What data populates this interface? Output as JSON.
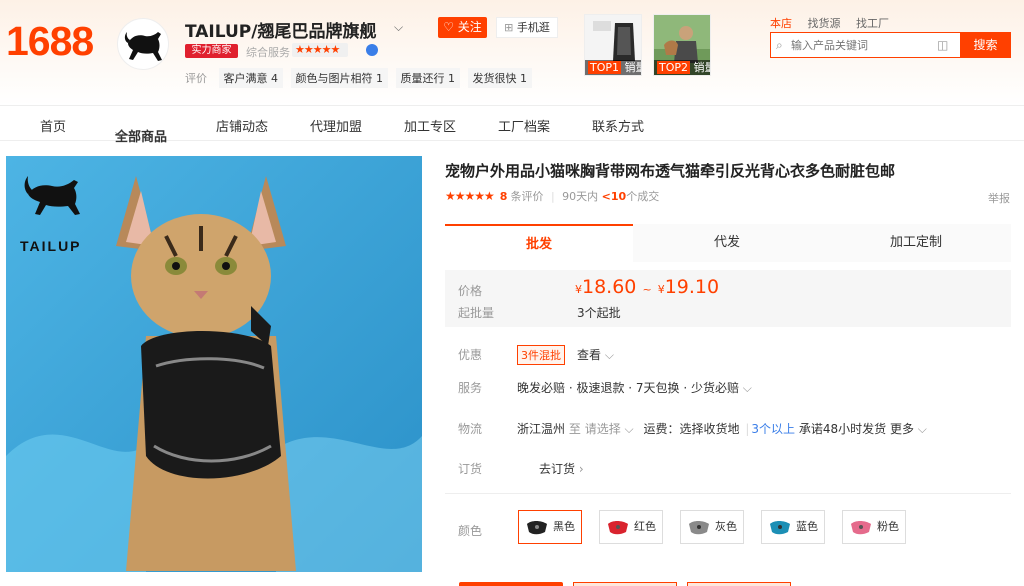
{
  "header": {
    "logo": "1688",
    "shop_name": "TAILUP/翘尾巴品牌旗舰",
    "follow_label": "关注",
    "mobile_label": "手机逛",
    "badge": "实力商家",
    "service_label": "综合服务",
    "stars": "★★★★★",
    "eval_label": "评价",
    "eval_tags": [
      "客户满意 4",
      "颜色与图片相符 1",
      "质量还行 1",
      "发货很快 1"
    ],
    "thumbs": [
      {
        "rank": "TOP1",
        "label": "销量"
      },
      {
        "rank": "TOP2",
        "label": "销量"
      }
    ],
    "search_tabs": [
      "本店",
      "找货源",
      "找工厂"
    ],
    "search_placeholder": "输入产品关键词",
    "search_button": "搜索"
  },
  "nav": [
    "首页",
    "全部商品",
    "店铺动态",
    "代理加盟",
    "加工专区",
    "工厂档案",
    "联系方式"
  ],
  "product": {
    "brand_text": "TAILUP",
    "title": "宠物户外用品小猫咪胸背带网布透气猫牵引反光背心衣多色耐脏包邮",
    "stars": "★★★★★",
    "review_count": "8",
    "review_suffix": "条评价",
    "sales_prefix": "90天内",
    "sales_value": "<10",
    "sales_suffix": "个成交",
    "report": "举报",
    "tabs": [
      "批发",
      "代发",
      "加工定制"
    ],
    "price_label": "价格",
    "currency": "¥",
    "price_low": "18.60",
    "price_sep": "~",
    "price_high": "19.10",
    "moq_label": "起批量",
    "moq_value": "3个起批",
    "promo_label": "优惠",
    "promo_tag": "3件混批",
    "promo_view": "查看",
    "service_label": "服务",
    "service_value": "晚发必赔 · 极速退款 · 7天包换 · 少货必赔",
    "logistics_label": "物流",
    "logistics_from": "浙江温州",
    "logistics_to": "至",
    "logistics_select": "请选择",
    "logistics_fee": "运费：选择收货地",
    "logistics_qty": "3个以上",
    "logistics_promise": "承诺48小时发货",
    "logistics_more": "更多",
    "order_label": "订货",
    "order_value": "去订货",
    "color_label": "颜色",
    "colors": [
      {
        "name": "黑色",
        "hex": "#222222"
      },
      {
        "name": "红色",
        "hex": "#d9232e"
      },
      {
        "name": "灰色",
        "hex": "#8a8a8a"
      },
      {
        "name": "蓝色",
        "hex": "#1c8fb5"
      },
      {
        "name": "粉色",
        "hex": "#e56b8c"
      }
    ]
  },
  "colors": {
    "accent": "#ff4000"
  }
}
